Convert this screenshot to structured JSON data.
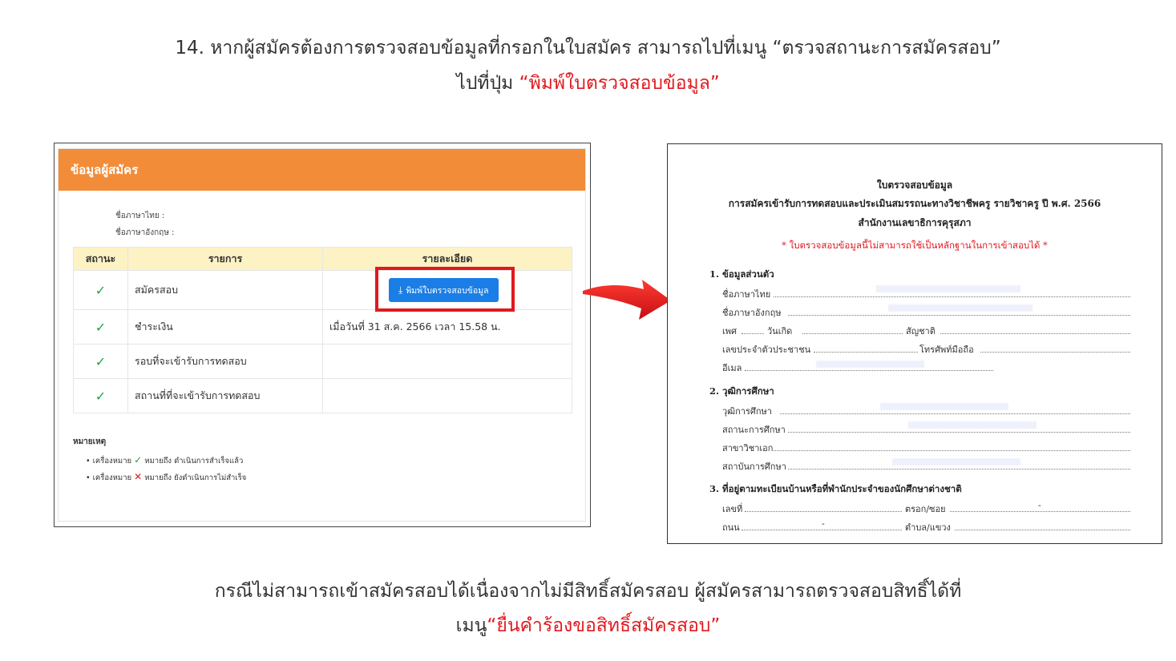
{
  "instructions": {
    "top_line1": "14. หากผู้สมัครต้องการตรวจสอบข้อมูลที่กรอกในใบสมัคร สามารถไปที่เมนู “ตรวจสถานะการสมัครสอบ”",
    "top_line2_prefix": "ไปที่ปุ่ม ",
    "top_line2_highlight": "“พิมพ์ใบตรวจสอบข้อมูล”",
    "bottom_line1": "กรณีไม่สามารถเข้าสมัครสอบได้เนื่องจากไม่มีสิทธิ์สมัครสอบ ผู้สมัครสามารถตรวจสอบสิทธิ์ได้ที่",
    "bottom_line2_prefix": "เมนู",
    "bottom_line2_highlight": "“ยื่นคำร้องขอสิทธิ์สมัครสอบ”"
  },
  "applicant_panel": {
    "header": "ข้อมูลผู้สมัคร",
    "name_thai_label": "ชื่อภาษาไทย  :",
    "name_english_label": "ชื่อภาษาอังกฤษ  :",
    "table": {
      "headers": [
        "สถานะ",
        "รายการ",
        "รายละเอียด"
      ],
      "rows": [
        {
          "status": "✓",
          "item": "สมัครสอบ",
          "detail": ""
        },
        {
          "status": "✓",
          "item": "ชำระเงิน",
          "detail": "เมื่อวันที่  31  ส.ค.  2566  เวลา  15.58  น."
        },
        {
          "status": "✓",
          "item": "รอบที่จะเข้ารับการทดสอบ",
          "detail": ""
        },
        {
          "status": "✓",
          "item": "สถานที่ที่จะเข้ารับการทดสอบ",
          "detail": ""
        }
      ]
    },
    "print_button": "พิมพ์ใบตรวจสอบข้อมูล",
    "note_title": "หมายเหตุ",
    "note1_prefix": "เครื่องหมาย",
    "note1_icon": "✓",
    "note1_text": "หมายถึง  ดำเนินการสำเร็จแล้ว",
    "note2_prefix": "เครื่องหมาย",
    "note2_icon": "✕",
    "note2_text": "หมายถึง  ยังดำเนินการไม่สำเร็จ"
  },
  "document": {
    "title": "ใบตรวจสอบข้อมูล",
    "subtitle": "การสมัครเข้ารับการทดสอบและประเมินสมรรถนะทางวิชาชีพครู รายวิชาครู ปี พ.ศ. 2566",
    "organization": "สำนักงานเลขาธิการคุรุสภา",
    "warning": "* ใบตรวจสอบข้อมูลนี้ไม่สามารถใช้เป็นหลักฐานในการเข้าสอบได้ *",
    "section1": "1. ข้อมูลส่วนตัว",
    "s1_name_th": "ชื่อภาษาไทย",
    "s1_name_en": "ชื่อภาษาอังกฤษ",
    "s1_gender": "เพศ",
    "s1_birth": "วันเกิด",
    "s1_nationality": "สัญชาติ",
    "s1_id": "เลขประจำตัวประชาชน",
    "s1_mobile": "โทรศัพท์มือถือ",
    "s1_email": "อีเมล",
    "section2": "2. วุฒิการศึกษา",
    "s2_degree": "วุฒิการศึกษา",
    "s2_status": "สถานะการศึกษา",
    "s2_major": "สาขาวิชาเอก",
    "s2_institution": "สถาบันการศึกษา",
    "section3": "3. ที่อยู่ตามทะเบียนบ้านหรือที่พำนักประจำของนักศึกษาต่างชาติ",
    "s3_number": "เลขที่",
    "s3_alley": "ตรอก/ซอย",
    "s3_road": "ถนน",
    "s3_subdistrict": "ตำบล/แขวง",
    "dash": "-"
  },
  "colors": {
    "orange_header": "#f28c38",
    "accent_red": "#e0191f",
    "button_blue": "#1a7ee6",
    "check_green": "#25a244",
    "table_header_bg": "#fdf2c4"
  },
  "icons": {
    "arrow": "curved-red-arrow-icon",
    "download": "download-icon",
    "check": "check-icon",
    "cross": "cross-icon"
  }
}
